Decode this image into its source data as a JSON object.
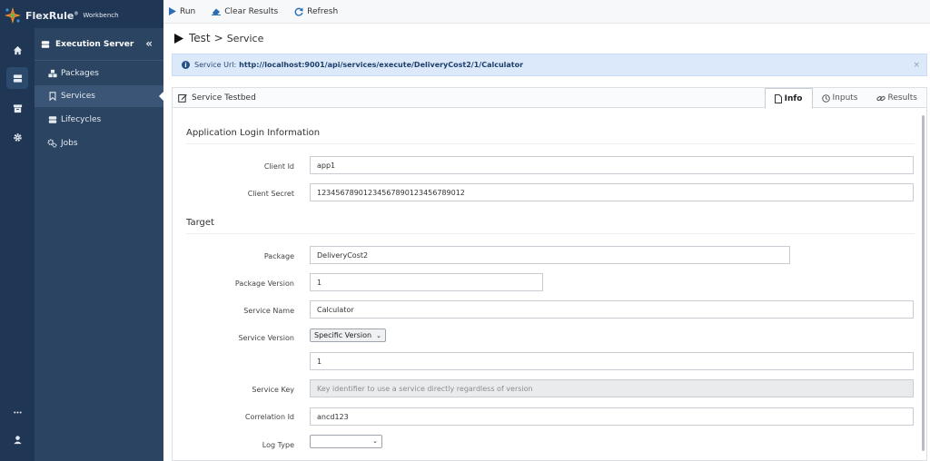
{
  "app": {
    "brand": "FlexRule",
    "brand_suffix": "Workbench",
    "brand_mark": "®"
  },
  "rail": {
    "icons": [
      "home-icon",
      "server-icon",
      "archive-icon",
      "gear-icon",
      "more-icon",
      "user-icon"
    ]
  },
  "nav": {
    "header": "Execution Server",
    "collapse_glyph": "«",
    "items": [
      {
        "label": "Packages",
        "icon": "packages-icon"
      },
      {
        "label": "Services",
        "icon": "bookmark-icon"
      },
      {
        "label": "Lifecycles",
        "icon": "lifecycles-icon"
      },
      {
        "label": "Jobs",
        "icon": "jobs-icon"
      }
    ]
  },
  "toolbar": {
    "run": "Run",
    "clear": "Clear Results",
    "refresh": "Refresh"
  },
  "breadcrumb": {
    "root": "Test",
    "sep": ">",
    "leaf": "Service"
  },
  "banner": {
    "label": "Service Url:",
    "url": "http://localhost:9001/api/services/execute/DeliveryCost2/1/Calculator",
    "close": "×"
  },
  "testbed": {
    "title": "Service Testbed",
    "tabs": {
      "info": "Info",
      "inputs": "Inputs",
      "results": "Results"
    }
  },
  "form": {
    "login_section": "Application Login Information",
    "client_id_label": "Client Id",
    "client_id": "app1",
    "client_secret_label": "Client Secret",
    "client_secret": "12345678901234567890123456789012",
    "target_section": "Target",
    "package_label": "Package",
    "package": "DeliveryCost2",
    "package_version_label": "Package Version",
    "package_version": "1",
    "service_name_label": "Service Name",
    "service_name": "Calculator",
    "service_version_label": "Service Version",
    "service_version_mode": "Specific Version",
    "service_version": "1",
    "service_key_label": "Service Key",
    "service_key_placeholder": "Key identifier to use a service directly regardless of version",
    "correlation_id_label": "Correlation Id",
    "correlation_id": "ancd123",
    "log_type_label": "Log Type"
  },
  "colors": {
    "rail": "#1f3654",
    "nav": "#2a4462",
    "nav_active": "#3a5576",
    "banner": "#dbe9fb",
    "accent": "#234e86"
  }
}
